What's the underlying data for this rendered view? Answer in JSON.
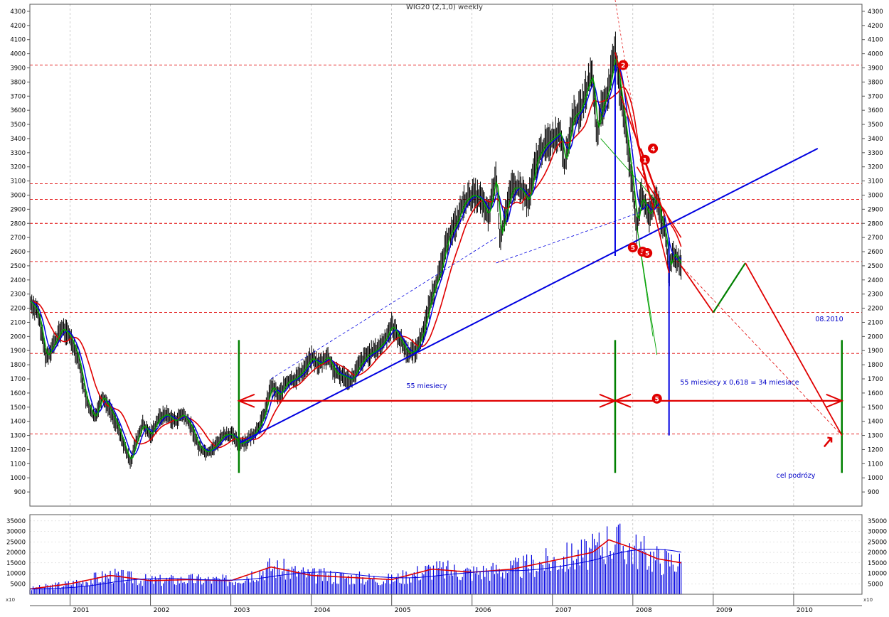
{
  "chart_data": {
    "type": "line",
    "title": "WIG20 (2,1,0) weekly",
    "price_axis": {
      "ylim": [
        800,
        4350
      ],
      "ticks": [
        900,
        1000,
        1100,
        1200,
        1300,
        1400,
        1500,
        1600,
        1700,
        1800,
        1900,
        2000,
        2100,
        2200,
        2300,
        2400,
        2500,
        2600,
        2700,
        2800,
        2900,
        3000,
        3100,
        3200,
        3300,
        3400,
        3500,
        3600,
        3700,
        3800,
        3900,
        4000,
        4100,
        4200,
        4300
      ]
    },
    "volume_axis": {
      "ylim": [
        0,
        38000
      ],
      "ticks": [
        5000,
        10000,
        15000,
        20000,
        25000,
        30000,
        35000
      ],
      "unit_label": "x10"
    },
    "x_axis": {
      "xlim": [
        2000.5,
        2010.85
      ],
      "year_labels": [
        "2001",
        "2002",
        "2003",
        "2004",
        "2005",
        "2006",
        "2007",
        "2008",
        "2009",
        "2010"
      ]
    },
    "price_series": [
      {
        "x": 2000.5,
        "y": 2250
      },
      {
        "x": 2000.6,
        "y": 2170
      },
      {
        "x": 2000.7,
        "y": 1850
      },
      {
        "x": 2000.8,
        "y": 1950
      },
      {
        "x": 2000.9,
        "y": 2060
      },
      {
        "x": 2001.0,
        "y": 2000
      },
      {
        "x": 2001.1,
        "y": 1850
      },
      {
        "x": 2001.2,
        "y": 1550
      },
      {
        "x": 2001.3,
        "y": 1420
      },
      {
        "x": 2001.4,
        "y": 1580
      },
      {
        "x": 2001.5,
        "y": 1480
      },
      {
        "x": 2001.6,
        "y": 1350
      },
      {
        "x": 2001.7,
        "y": 1180
      },
      {
        "x": 2001.75,
        "y": 1110
      },
      {
        "x": 2001.8,
        "y": 1220
      },
      {
        "x": 2001.9,
        "y": 1380
      },
      {
        "x": 2002.0,
        "y": 1300
      },
      {
        "x": 2002.1,
        "y": 1420
      },
      {
        "x": 2002.2,
        "y": 1450
      },
      {
        "x": 2002.3,
        "y": 1400
      },
      {
        "x": 2002.4,
        "y": 1450
      },
      {
        "x": 2002.5,
        "y": 1370
      },
      {
        "x": 2002.6,
        "y": 1220
      },
      {
        "x": 2002.7,
        "y": 1180
      },
      {
        "x": 2002.8,
        "y": 1220
      },
      {
        "x": 2002.9,
        "y": 1300
      },
      {
        "x": 2003.0,
        "y": 1310
      },
      {
        "x": 2003.1,
        "y": 1240
      },
      {
        "x": 2003.2,
        "y": 1260
      },
      {
        "x": 2003.3,
        "y": 1320
      },
      {
        "x": 2003.4,
        "y": 1420
      },
      {
        "x": 2003.5,
        "y": 1650
      },
      {
        "x": 2003.6,
        "y": 1580
      },
      {
        "x": 2003.7,
        "y": 1680
      },
      {
        "x": 2003.8,
        "y": 1700
      },
      {
        "x": 2003.9,
        "y": 1760
      },
      {
        "x": 2004.0,
        "y": 1850
      },
      {
        "x": 2004.1,
        "y": 1800
      },
      {
        "x": 2004.2,
        "y": 1860
      },
      {
        "x": 2004.3,
        "y": 1740
      },
      {
        "x": 2004.4,
        "y": 1720
      },
      {
        "x": 2004.5,
        "y": 1690
      },
      {
        "x": 2004.6,
        "y": 1800
      },
      {
        "x": 2004.7,
        "y": 1870
      },
      {
        "x": 2004.8,
        "y": 1900
      },
      {
        "x": 2004.9,
        "y": 1960
      },
      {
        "x": 2005.0,
        "y": 2080
      },
      {
        "x": 2005.1,
        "y": 1980
      },
      {
        "x": 2005.2,
        "y": 1880
      },
      {
        "x": 2005.3,
        "y": 1900
      },
      {
        "x": 2005.4,
        "y": 2050
      },
      {
        "x": 2005.5,
        "y": 2300
      },
      {
        "x": 2005.6,
        "y": 2450
      },
      {
        "x": 2005.7,
        "y": 2700
      },
      {
        "x": 2005.8,
        "y": 2800
      },
      {
        "x": 2005.9,
        "y": 2950
      },
      {
        "x": 2006.0,
        "y": 3000
      },
      {
        "x": 2006.1,
        "y": 2980
      },
      {
        "x": 2006.2,
        "y": 2850
      },
      {
        "x": 2006.3,
        "y": 3150
      },
      {
        "x": 2006.35,
        "y": 2650
      },
      {
        "x": 2006.4,
        "y": 2850
      },
      {
        "x": 2006.5,
        "y": 3050
      },
      {
        "x": 2006.6,
        "y": 3050
      },
      {
        "x": 2006.7,
        "y": 2950
      },
      {
        "x": 2006.8,
        "y": 3250
      },
      {
        "x": 2006.9,
        "y": 3350
      },
      {
        "x": 2007.0,
        "y": 3400
      },
      {
        "x": 2007.1,
        "y": 3450
      },
      {
        "x": 2007.15,
        "y": 3200
      },
      {
        "x": 2007.25,
        "y": 3550
      },
      {
        "x": 2007.35,
        "y": 3600
      },
      {
        "x": 2007.45,
        "y": 3800
      },
      {
        "x": 2007.5,
        "y": 3850
      },
      {
        "x": 2007.55,
        "y": 3400
      },
      {
        "x": 2007.6,
        "y": 3600
      },
      {
        "x": 2007.7,
        "y": 3750
      },
      {
        "x": 2007.78,
        "y": 4020
      },
      {
        "x": 2007.85,
        "y": 3700
      },
      {
        "x": 2007.9,
        "y": 3500
      },
      {
        "x": 2008.0,
        "y": 3050
      },
      {
        "x": 2008.05,
        "y": 2750
      },
      {
        "x": 2008.1,
        "y": 3000
      },
      {
        "x": 2008.2,
        "y": 2850
      },
      {
        "x": 2008.3,
        "y": 3000
      },
      {
        "x": 2008.35,
        "y": 2800
      },
      {
        "x": 2008.4,
        "y": 2750
      },
      {
        "x": 2008.45,
        "y": 2450
      },
      {
        "x": 2008.5,
        "y": 2600
      },
      {
        "x": 2008.55,
        "y": 2550
      },
      {
        "x": 2008.6,
        "y": 2500
      }
    ],
    "volume_series": [
      {
        "x": 2000.5,
        "y": 2500
      },
      {
        "x": 2001.0,
        "y": 5000
      },
      {
        "x": 2001.5,
        "y": 9000
      },
      {
        "x": 2002.0,
        "y": 6500
      },
      {
        "x": 2002.5,
        "y": 7000
      },
      {
        "x": 2003.0,
        "y": 6500
      },
      {
        "x": 2003.5,
        "y": 13000
      },
      {
        "x": 2004.0,
        "y": 9000
      },
      {
        "x": 2004.5,
        "y": 8000
      },
      {
        "x": 2005.0,
        "y": 7000
      },
      {
        "x": 2005.5,
        "y": 12000
      },
      {
        "x": 2006.0,
        "y": 10500
      },
      {
        "x": 2006.5,
        "y": 12000
      },
      {
        "x": 2007.0,
        "y": 16000
      },
      {
        "x": 2007.5,
        "y": 20000
      },
      {
        "x": 2007.7,
        "y": 26000
      },
      {
        "x": 2008.0,
        "y": 22000
      },
      {
        "x": 2008.3,
        "y": 17000
      },
      {
        "x": 2008.6,
        "y": 15000
      }
    ],
    "horizontal_levels": [
      3920,
      3080,
      2970,
      2800,
      2530,
      2170,
      1880,
      1310
    ],
    "annotations": {
      "months_label": "55 miesiecy",
      "fib_label": "55 miesiecy x 0,618 = 34 miesiace",
      "date_label": "08.2010",
      "target_label": "cel podrózy",
      "wave_markers": [
        "1",
        "2",
        "3",
        "4",
        "5",
        "5",
        "5"
      ]
    },
    "projection": [
      {
        "x": 2009.0,
        "y": 2170
      },
      {
        "x": 2009.4,
        "y": 2520
      },
      {
        "x": 2010.6,
        "y": 1300
      }
    ],
    "colors": {
      "price": "#000000",
      "ma_fast": "#00a000",
      "ma_mid": "#0000e0",
      "ma_slow": "#e00000",
      "level_line": "#e00000",
      "trendline": "#0000e0",
      "time_marker": "#008000",
      "volume_bar": "#0000e0",
      "volume_ma": "#e00000"
    }
  }
}
